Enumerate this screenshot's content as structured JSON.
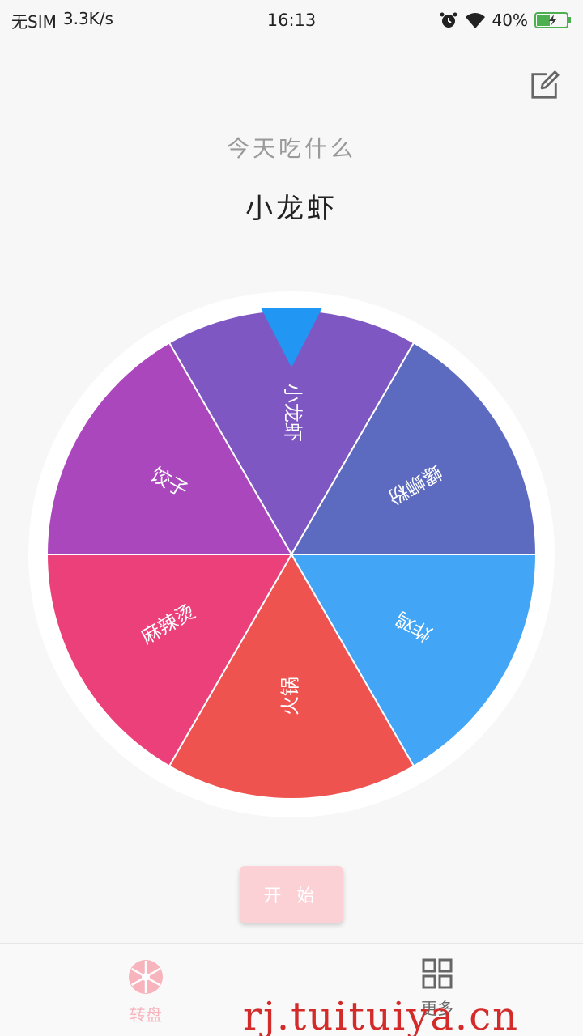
{
  "status_bar": {
    "carrier": "无SIM",
    "speed": "3.3K/s",
    "time": "16:13",
    "battery": "40%",
    "icons": [
      "alarm-icon",
      "wifi-icon",
      "battery-charging-icon"
    ]
  },
  "header": {
    "edit_icon": "edit-icon",
    "subtitle": "今天吃什么",
    "result": "小龙虾"
  },
  "wheel": {
    "pointer_color": "#2196f3",
    "segments": [
      {
        "label": "小龙虾",
        "color": "#7e57c2"
      },
      {
        "label": "螺蛳粉",
        "color": "#5c6bc0"
      },
      {
        "label": "炸鸡",
        "color": "#42a5f5"
      },
      {
        "label": "火锅",
        "color": "#ef5350"
      },
      {
        "label": "麻辣烫",
        "color": "#ec407a"
      },
      {
        "label": "饺子",
        "color": "#ab47bc"
      }
    ]
  },
  "start_button": {
    "label": "开 始",
    "color": "#fcd1d6"
  },
  "tabs": [
    {
      "label": "转盘",
      "icon": "wheel-icon",
      "active": true
    },
    {
      "label": "更多",
      "icon": "grid-icon",
      "active": false
    }
  ],
  "watermark": "rj.tuituiya.cn"
}
